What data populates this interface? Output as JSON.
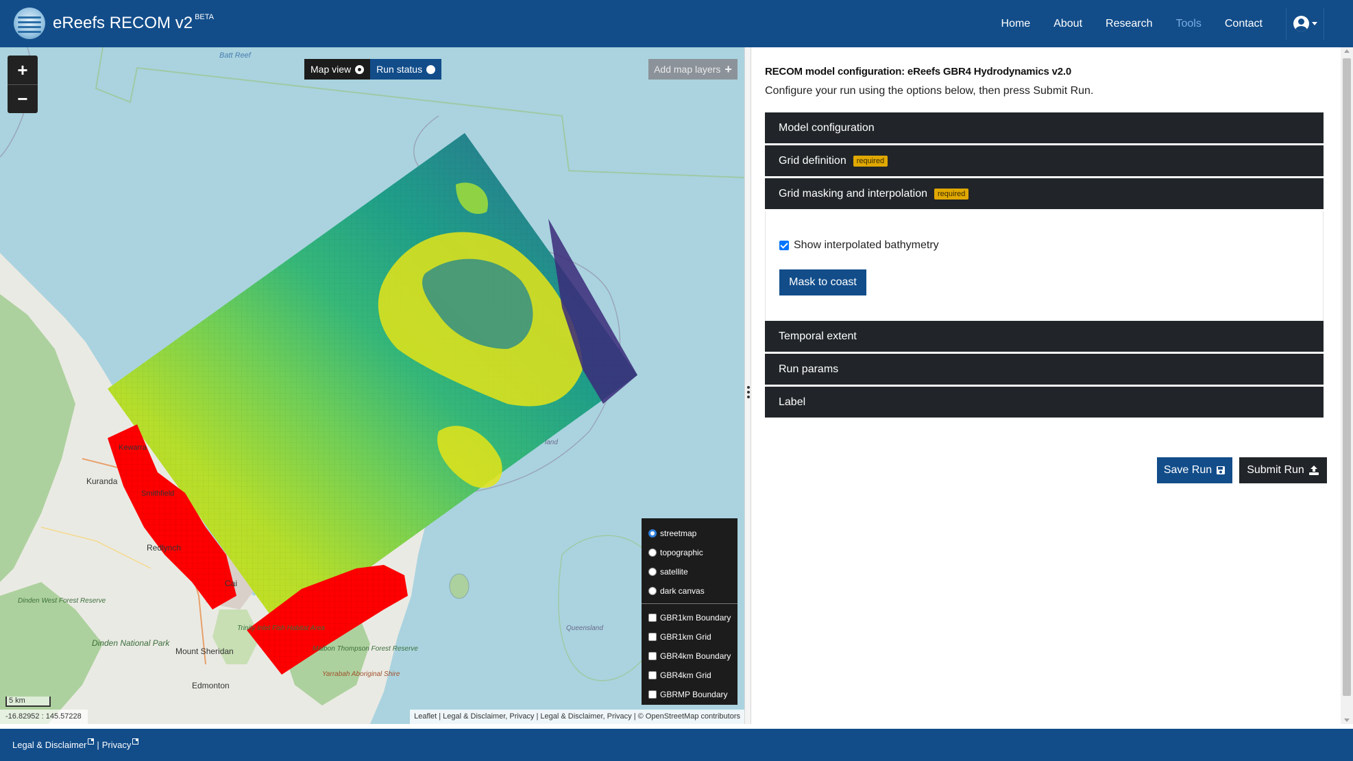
{
  "header": {
    "app_title": "eReefs RECOM v2",
    "beta_label": "BETA",
    "nav": [
      {
        "label": "Home"
      },
      {
        "label": "About"
      },
      {
        "label": "Research"
      },
      {
        "label": "Tools",
        "active": true
      },
      {
        "label": "Contact"
      }
    ]
  },
  "map": {
    "view_toggle": {
      "map_view": "Map view",
      "run_status": "Run status"
    },
    "add_layers_label": "Add map layers",
    "zoom_in": "+",
    "zoom_out": "−",
    "basemaps": [
      {
        "label": "streetmap",
        "selected": true
      },
      {
        "label": "topographic",
        "selected": false
      },
      {
        "label": "satellite",
        "selected": false
      },
      {
        "label": "dark canvas",
        "selected": false
      }
    ],
    "overlays": [
      {
        "label": "GBR1km Boundary",
        "checked": false
      },
      {
        "label": "GBR1km Grid",
        "checked": false
      },
      {
        "label": "GBR4km Boundary",
        "checked": false
      },
      {
        "label": "GBR4km Grid",
        "checked": false
      },
      {
        "label": "GBRMP Boundary",
        "checked": false
      }
    ],
    "scale_label": "5 km",
    "coords": "-16.82952 : 145.57228",
    "attribution": "Leaflet | Legal & Disclaimer, Privacy | Legal & Disclaimer, Privacy | © OpenStreetMap contributors",
    "place_labels": [
      "Batt Reef",
      "Kewarra",
      "Kuranda",
      "Smithfield",
      "Redlynch",
      "Cai",
      "Dinden West Forest Reserve",
      "Dinden National Park",
      "Mount Sheridan",
      "Trinity Inlet Fish Habitat Area",
      "Malbon Thompson Forest Reserve",
      "Yarrabah Aboriginal Shire",
      "Edmonton",
      "Queensland",
      "land"
    ],
    "colors": {
      "sea": "#aad3df",
      "land": "#eaeae4",
      "forest": "#add19e",
      "mask": "#ff0000"
    }
  },
  "config": {
    "title": "RECOM model configuration: eReefs GBR4 Hydrodynamics v2.0",
    "subtitle": "Configure your run using the options below, then press Submit Run.",
    "sections": [
      {
        "label": "Model configuration",
        "badge": ""
      },
      {
        "label": "Grid definition",
        "badge": "required"
      },
      {
        "label": "Grid masking and interpolation",
        "badge": "required"
      },
      {
        "label": "Temporal extent",
        "badge": ""
      },
      {
        "label": "Run params",
        "badge": ""
      },
      {
        "label": "Label",
        "badge": ""
      }
    ],
    "show_bathy_label": "Show interpolated bathymetry",
    "show_bathy_checked": true,
    "mask_button": "Mask to coast",
    "save_button": "Save Run",
    "submit_button": "Submit Run"
  },
  "footer": {
    "legal": "Legal & Disclaimer",
    "privacy": "Privacy"
  }
}
